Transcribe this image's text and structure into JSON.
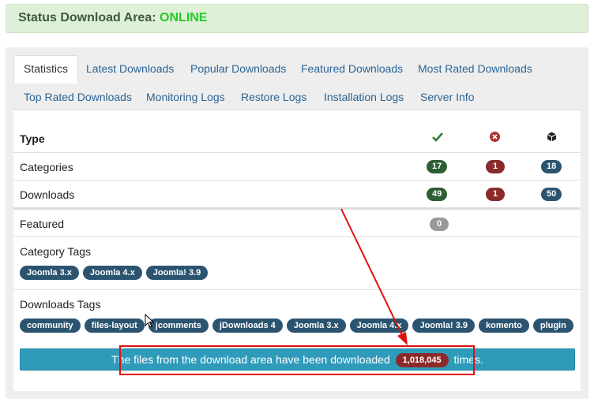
{
  "status": {
    "label": "Status Download Area:",
    "value": "ONLINE"
  },
  "tabs": [
    "Statistics",
    "Latest Downloads",
    "Popular Downloads",
    "Featured Downloads",
    "Most Rated Downloads",
    "Top Rated Downloads",
    "Monitoring Logs",
    "Restore Logs",
    "Installation Logs",
    "Server Info"
  ],
  "table": {
    "header": "Type",
    "header_icons": [
      "check-icon",
      "cross-circle-icon",
      "cube-icon"
    ],
    "rows": [
      {
        "label": "Categories",
        "published": "17",
        "unpublished": "1",
        "total": "18"
      },
      {
        "label": "Downloads",
        "published": "49",
        "unpublished": "1",
        "total": "50"
      },
      {
        "label": "Featured",
        "published": "0"
      }
    ]
  },
  "category_tags": {
    "label": "Category Tags",
    "tags": [
      "Joomla 3.x",
      "Joomla 4.x",
      "Joomla! 3.9"
    ]
  },
  "download_tags": {
    "label": "Downloads Tags",
    "tags": [
      "community",
      "files-layout",
      "jcomments",
      "jDownloads 4",
      "Joomla 3.x",
      "Joomla 4.x",
      "Joomla! 3.9",
      "komento",
      "plugin"
    ]
  },
  "info": {
    "text_before": "The files from the download area have been downloaded",
    "count": "1,018,045",
    "text_after": "times."
  },
  "colors": {
    "online": "#22cc22",
    "published": "#2e5e34",
    "unpublished": "#8b2a2a",
    "total": "#2b5470",
    "info_bar": "#2f9bba",
    "annotation": "#e01010"
  }
}
